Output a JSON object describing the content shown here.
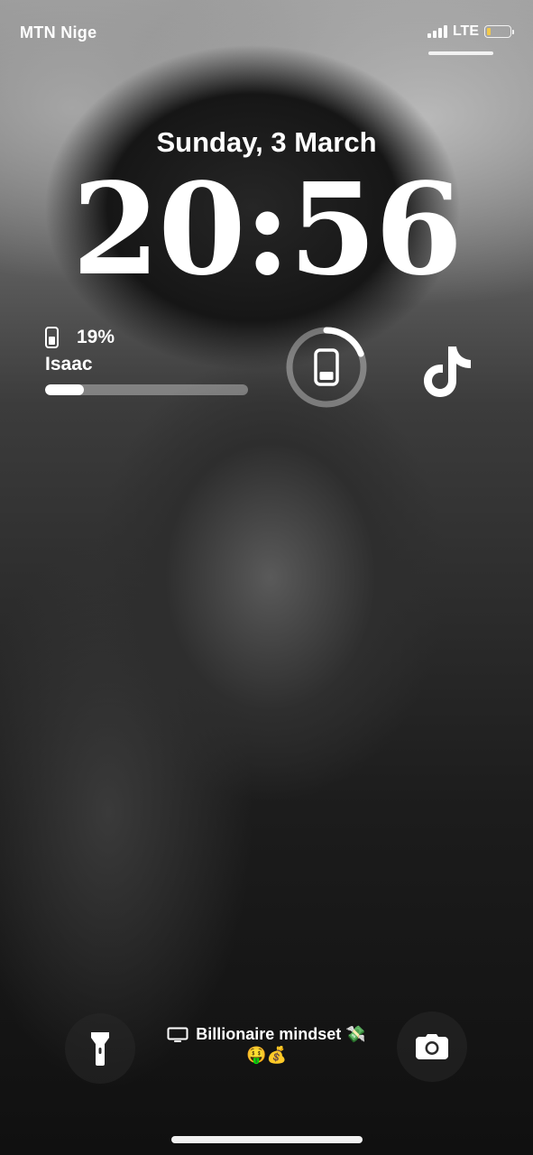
{
  "status_bar": {
    "carrier": "MTN Nige",
    "network": "LTE",
    "signal_bars": 4,
    "battery_level": 0.19,
    "battery_color": "#f2c94c"
  },
  "lock_screen": {
    "date": "Sunday, 3 March",
    "time": "20:56"
  },
  "widgets": {
    "battery": {
      "icon": "phone-icon",
      "percent_label": "19%",
      "level": 0.19,
      "device_name": "Isaac"
    },
    "battery_ring": {
      "icon": "phone-icon",
      "level": 0.19
    },
    "tiktok": {
      "icon": "tiktok-icon"
    }
  },
  "focus": {
    "icon": "monitor-icon",
    "label": "Billionaire mindset 💸",
    "emojis": "🤑💰"
  },
  "quick_actions": {
    "left": "flashlight-icon",
    "right": "camera-icon"
  }
}
